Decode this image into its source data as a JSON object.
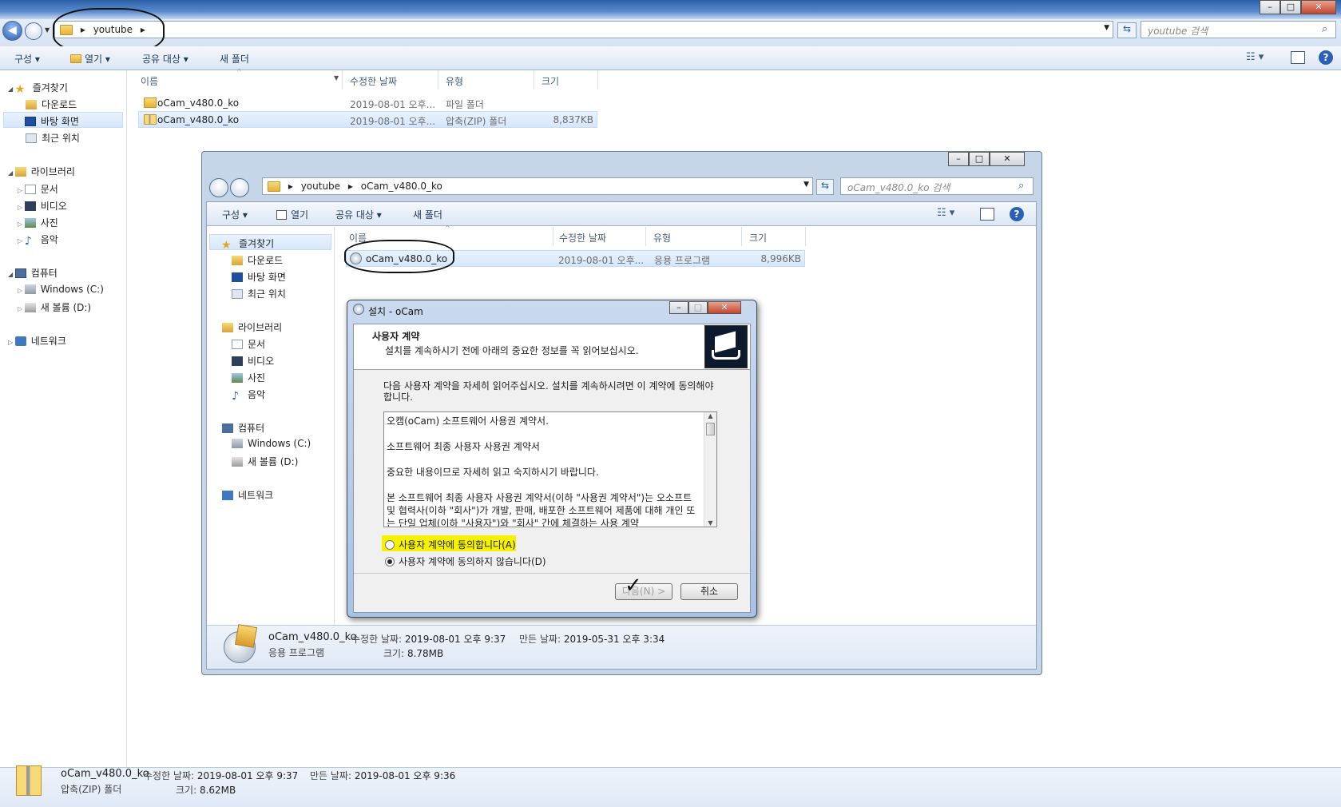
{
  "outer": {
    "breadcrumb": [
      "youtube"
    ],
    "search_placeholder": "youtube 검색",
    "toolbar": {
      "organize": "구성",
      "open": "열기",
      "share": "공유 대상",
      "new_folder": "새 폴더"
    },
    "sidebar": {
      "favorites": "즐겨찾기",
      "favorites_items": [
        "다운로드",
        "바탕 화면",
        "최근 위치"
      ],
      "libraries": "라이브러리",
      "libraries_items": [
        "문서",
        "비디오",
        "사진",
        "음악"
      ],
      "computer": "컴퓨터",
      "computer_items": [
        "Windows (C:)",
        "새 볼륨 (D:)"
      ],
      "network": "네트워크"
    },
    "columns": [
      "이름",
      "수정한 날짜",
      "유형",
      "크기"
    ],
    "files": [
      {
        "name": "oCam_v480.0_ko",
        "date": "2019-08-01 오후...",
        "type": "파일 폴더",
        "size": ""
      },
      {
        "name": "oCam_v480.0_ko",
        "date": "2019-08-01 오후...",
        "type": "압축(ZIP) 폴더",
        "size": "8,837KB"
      }
    ],
    "status": {
      "name": "oCam_v480.0_ko",
      "type": "압축(ZIP) 폴더",
      "modified_label": "수정한 날짜:",
      "modified": "2019-08-01 오후 9:37",
      "created_label": "만든 날짜:",
      "created": "2019-08-01 오후 9:36",
      "size_label": "크기:",
      "size": "8.62MB"
    }
  },
  "inner": {
    "breadcrumb": [
      "youtube",
      "oCam_v480.0_ko"
    ],
    "search_placeholder": "oCam_v480.0_ko 검색",
    "toolbar": {
      "organize": "구성",
      "open": "열기",
      "share": "공유 대상",
      "new_folder": "새 폴더"
    },
    "sidebar": {
      "favorites": "즐겨찾기",
      "favorites_items": [
        "다운로드",
        "바탕 화면",
        "최근 위치"
      ],
      "libraries": "라이브러리",
      "libraries_items": [
        "문서",
        "비디오",
        "사진",
        "음악"
      ],
      "computer": "컴퓨터",
      "computer_items": [
        "Windows (C:)",
        "새 볼륨 (D:)"
      ],
      "network": "네트워크"
    },
    "columns": [
      "이름",
      "수정한 날짜",
      "유형",
      "크기"
    ],
    "files": [
      {
        "name": "oCam_v480.0_ko",
        "date": "2019-08-01 오후...",
        "type": "응용 프로그램",
        "size": "8,996KB"
      }
    ],
    "status": {
      "name": "oCam_v480.0_ko",
      "type": "응용 프로그램",
      "modified_label": "수정한 날짜:",
      "modified": "2019-08-01 오후 9:37",
      "created_label": "만든 날짜:",
      "created": "2019-05-31 오후 3:34",
      "size_label": "크기:",
      "size": "8.78MB"
    }
  },
  "dialog": {
    "title": "설치 - oCam",
    "heading": "사용자 계약",
    "subheading": "설치를 계속하시기 전에 아래의 중요한 정보를 꼭 읽어보십시오.",
    "instruction": "다음 사용자 계약을 자세히 읽어주십시오. 설치를 계속하시려면 이 계약에 동의해야 합니다.",
    "license_lines": [
      "오캠(oCam) 소프트웨어 사용권 계약서.",
      "소프트웨어 최종 사용자 사용권 계약서",
      "중요한 내용이므로 자세히 읽고 숙지하시기 바랍니다.",
      "본 소프트웨어 최종 사용자 사용권 계약서(이하 \"사용권 계약서\")는 오소프트 및 협력사(이하 \"회사\")가 개발, 판매, 배포한 소프트웨어 제품에 대해 개인 또는 단일 업체(이하 \"사용자\")와 \"회사\" 간에 체결하는 사용 계약"
    ],
    "agree": "사용자 계약에 동의합니다(A)",
    "disagree": "사용자 계약에 동의하지 않습니다(D)",
    "next_button": "다음(N) >",
    "cancel_button": "취소"
  },
  "colors": {
    "highlight": "#f5f200",
    "accent": "#2b5fa6"
  }
}
